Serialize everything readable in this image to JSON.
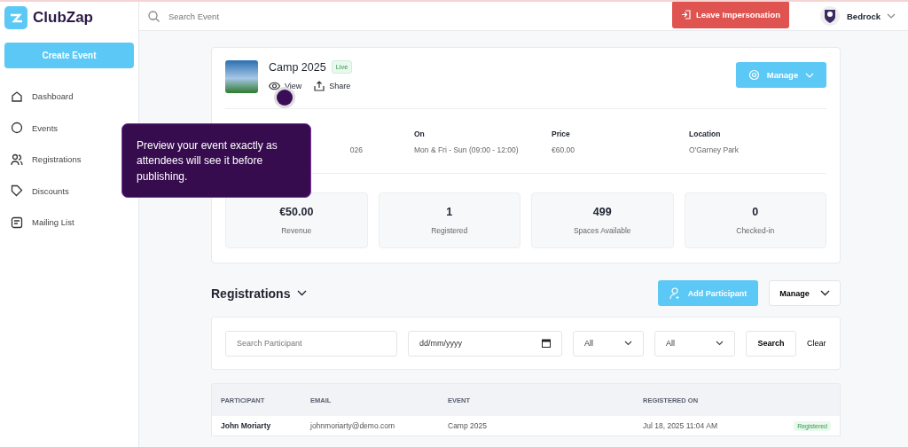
{
  "brand": {
    "name": "ClubZap"
  },
  "sidebar": {
    "create_button": "Create Event",
    "items": [
      {
        "label": "Dashboard"
      },
      {
        "label": "Events"
      },
      {
        "label": "Registrations"
      },
      {
        "label": "Discounts"
      },
      {
        "label": "Mailing List"
      }
    ]
  },
  "topbar": {
    "search": {
      "placeholder": "Search Event"
    },
    "leave_button": "Leave Impersonation",
    "account": "Bedrock"
  },
  "event": {
    "title": "Camp 2025",
    "status": "Live",
    "actions": [
      "View",
      "Share"
    ],
    "manage_button": "Manage",
    "details": [
      {
        "value": "026"
      },
      {
        "label": "On",
        "value": "Mon & Fri - Sun (09:00 - 12:00)"
      },
      {
        "label": "Price",
        "value": "€60.00"
      },
      {
        "label": "Location",
        "value": "O'Garney Park"
      }
    ],
    "stats": [
      {
        "value": "€50.00",
        "label": "Revenue"
      },
      {
        "value": "1",
        "label": "Registered"
      },
      {
        "value": "499",
        "label": "Spaces Available"
      },
      {
        "value": "0",
        "label": "Checked-in"
      }
    ]
  },
  "tooltip": {
    "text": "Preview your event exactly as attendees will see it before publishing."
  },
  "registrations": {
    "title": "Registrations",
    "add_button": "Add Participant",
    "manage_button": "Manage",
    "filters": {
      "search_placeholder": "Search Participant",
      "date_placeholder": "dd/mm/yyyy",
      "select_1": "All",
      "select_2": "All",
      "search_button": "Search",
      "clear_button": "Clear"
    },
    "table": {
      "columns": [
        "PARTICIPANT",
        "EMAIL",
        "EVENT",
        "REGISTERED ON"
      ],
      "rows": [
        {
          "participant": "John Moriarty",
          "email": "johnmoriarty@demo.com",
          "event": "Camp 2025",
          "registered_on": "Jul 18, 2025 11:04 AM",
          "status": "Registered"
        }
      ]
    }
  }
}
